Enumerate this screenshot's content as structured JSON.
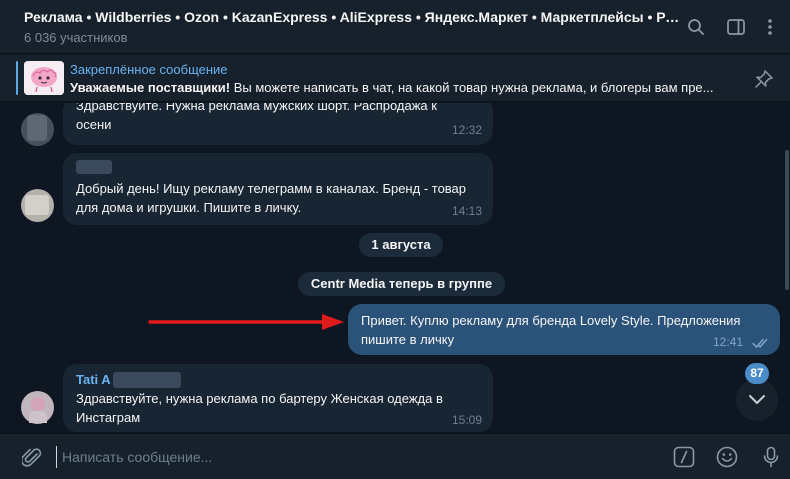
{
  "header": {
    "title": "Реклама • Wildberries • Ozon • KazanExpress • AliExpress • Яндекс.Маркет • Маркетплейсы • Реклама...",
    "members": "6 036 участников",
    "icons": [
      "search-icon",
      "sidebar-toggle-icon",
      "more-vertical-icon"
    ]
  },
  "pinned": {
    "title": "Закреплённое сообщение",
    "bold": "Уважаемые поставщики!",
    "text": " Вы можете написать в чат, на какой товар нужна реклама, и блогеры вам пре..."
  },
  "messages": [
    {
      "text": "Здравствуйте. Нужна реклама мужских шорт. Распродажа к осени",
      "time": "12:32"
    },
    {
      "text": "Добрый день! Ищу рекламу телеграмм в каналах. Бренд -  товар для дома и игрушки. Пишите в личку.",
      "time": "14:13"
    },
    {
      "text": "Привет. Куплю рекламу для бренда Lovely Style. Предложения пишите в личку",
      "time": "12:41"
    },
    {
      "sender": "Tati A",
      "text": "Здравствуйте, нужна реклама по бартеру Женская одежда в Инстаграм",
      "time": "15:09"
    }
  ],
  "service": {
    "date": "1 августа",
    "joined": "Centr Media теперь в группе"
  },
  "unread_count": "87",
  "composer": {
    "placeholder": "Написать сообщение..."
  },
  "colors": {
    "background": "#0e1621",
    "panel": "#17212b",
    "incoming_bubble": "#182533",
    "outgoing_bubble": "#2b5278",
    "accent": "#6ab3f3",
    "arrow": "#e01b1b"
  }
}
